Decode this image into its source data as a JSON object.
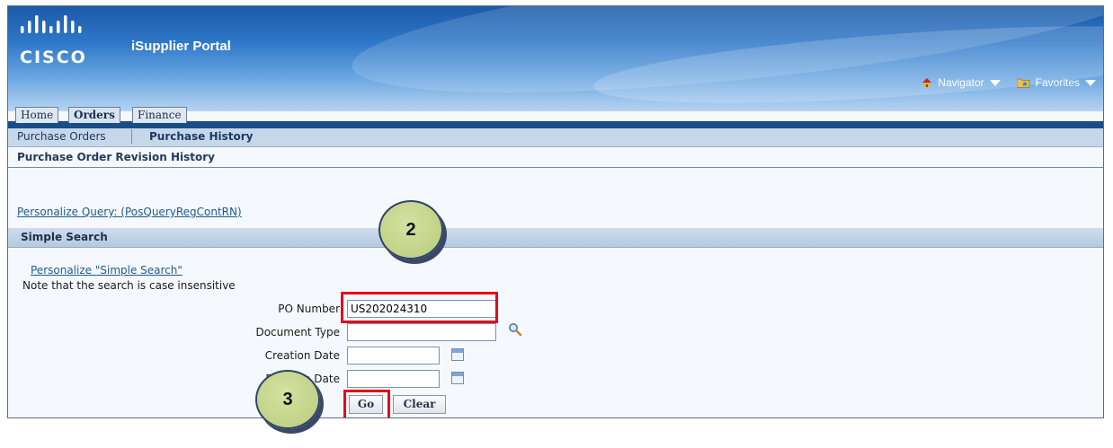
{
  "app": {
    "logo_text": "CISCO",
    "title": "iSupplier Portal"
  },
  "global_nav": {
    "navigator": "Navigator",
    "favorites": "Favorites"
  },
  "tabs": [
    "Home",
    "Orders",
    "Finance"
  ],
  "active_tab": "Orders",
  "subtabs": [
    "Purchase Orders",
    "Purchase History"
  ],
  "active_subtab": "Purchase History",
  "page": {
    "title": "Purchase Order Revision History",
    "personalize_query": "Personalize Query: (PosQueryRegContRN)"
  },
  "simple_search": {
    "title": "Simple Search",
    "personalize_link": "Personalize \"Simple Search\"",
    "note": "Note that the search is case insensitive",
    "fields": {
      "po_number": {
        "label": "PO Number",
        "value": "US202024310"
      },
      "document_type": {
        "label": "Document Type",
        "value": ""
      },
      "creation_date": {
        "label": "Creation Date",
        "value": ""
      },
      "revision_date": {
        "label": "Revision Date",
        "value": ""
      }
    },
    "go_button": "Go",
    "clear_button": "Clear"
  },
  "callouts": [
    "2",
    "3"
  ],
  "colors": {
    "highlight": "#e10b1c",
    "callout_fill": "#c5d68c",
    "banner": "#2f78c8"
  }
}
